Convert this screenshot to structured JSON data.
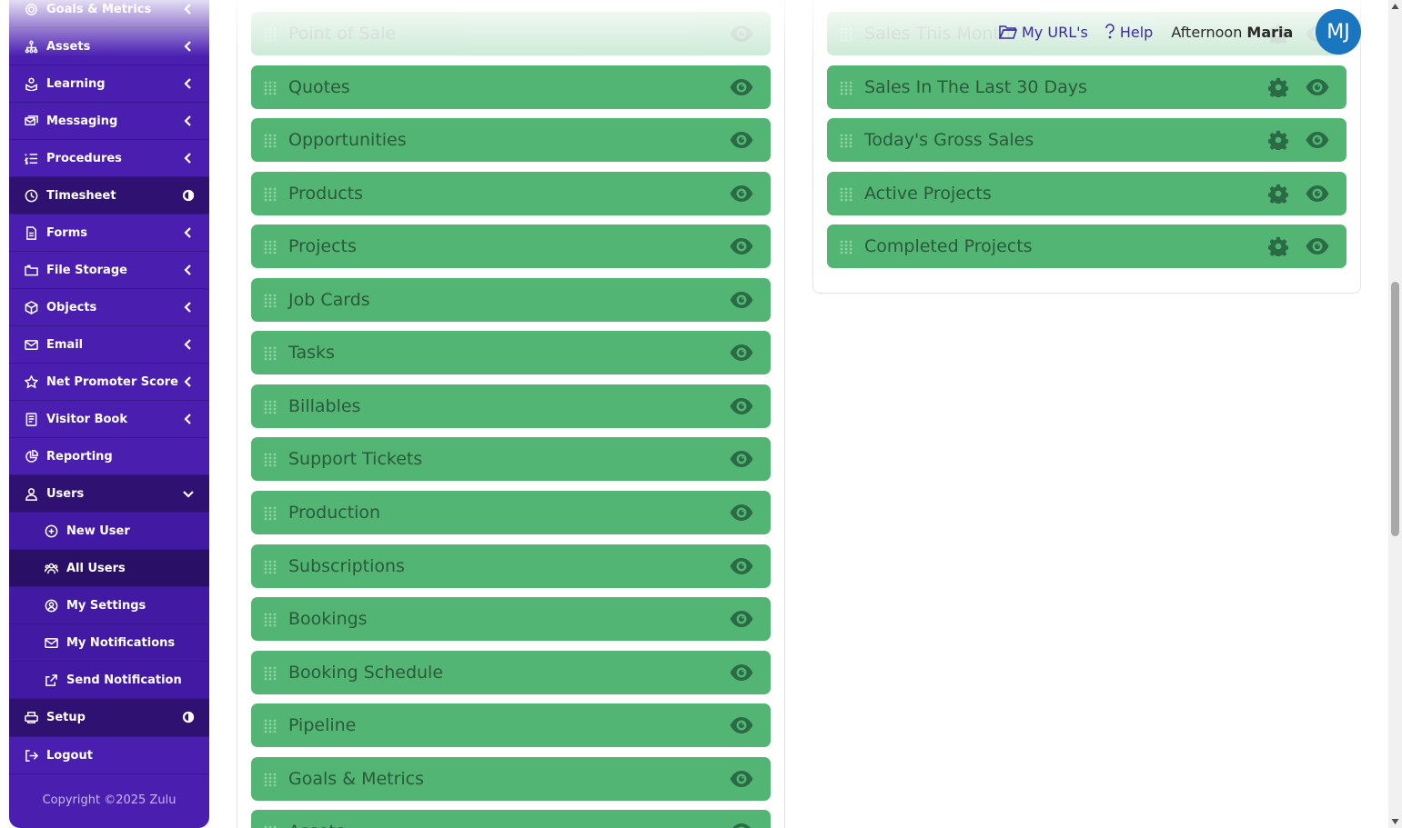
{
  "sidebar": {
    "items": [
      {
        "label": "Goals & Metrics",
        "icon": "target-icon"
      },
      {
        "label": "Assets",
        "icon": "hierarchy-icon"
      },
      {
        "label": "Learning",
        "icon": "learning-icon"
      },
      {
        "label": "Messaging",
        "icon": "messaging-icon"
      },
      {
        "label": "Procedures",
        "icon": "list-icon"
      },
      {
        "label": "Timesheet",
        "icon": "clock-icon"
      },
      {
        "label": "Forms",
        "icon": "form-icon"
      },
      {
        "label": "File Storage",
        "icon": "folder-icon"
      },
      {
        "label": "Objects",
        "icon": "cube-icon"
      },
      {
        "label": "Email",
        "icon": "envelope-icon"
      },
      {
        "label": "Net Promoter Score",
        "icon": "star-icon"
      },
      {
        "label": "Visitor Book",
        "icon": "book-icon"
      },
      {
        "label": "Reporting",
        "icon": "pie-chart-icon"
      },
      {
        "label": "Users",
        "icon": "user-icon"
      }
    ],
    "users_sub": [
      {
        "label": "New User",
        "icon": "plus-circle-icon"
      },
      {
        "label": "All Users",
        "icon": "users-icon"
      },
      {
        "label": "My Settings",
        "icon": "user-circle-icon"
      },
      {
        "label": "My Notifications",
        "icon": "envelope-icon"
      },
      {
        "label": "Send Notification",
        "icon": "share-icon"
      }
    ],
    "bottom": [
      {
        "label": "Setup",
        "icon": "printer-icon"
      },
      {
        "label": "Logout",
        "icon": "logout-icon"
      }
    ],
    "copyright": "Copyright ©2025 Zulu"
  },
  "topbar": {
    "my_urls": "My URL's",
    "help": "Help",
    "greeting": "Afternoon",
    "user_name": "Maria",
    "avatar_initials": "MJ"
  },
  "left_widgets": [
    "Point of Sale",
    "Quotes",
    "Opportunities",
    "Products",
    "Projects",
    "Job Cards",
    "Tasks",
    "Billables",
    "Support Tickets",
    "Production",
    "Subscriptions",
    "Bookings",
    "Booking Schedule",
    "Pipeline",
    "Goals & Metrics",
    "Assets"
  ],
  "right_widgets": [
    "Sales This Month",
    "Sales In The Last 30 Days",
    "Today's Gross Sales",
    "Active Projects",
    "Completed Projects"
  ],
  "colors": {
    "sidebar": "#4a1fb0",
    "widget": "#52b574",
    "widget_text": "#2b5a3a",
    "avatar": "#1a76bf"
  }
}
